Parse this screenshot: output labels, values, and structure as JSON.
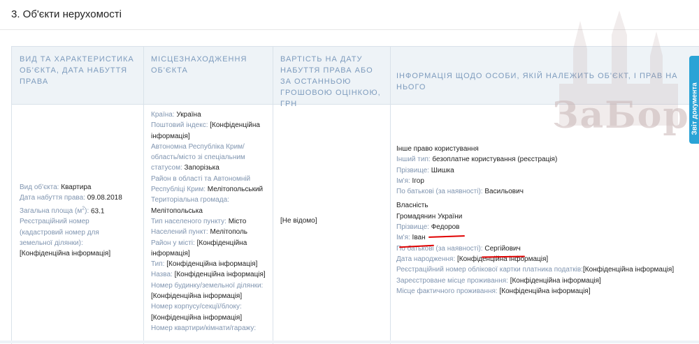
{
  "section": {
    "title": "3. Об'єкти нерухомості"
  },
  "headers": {
    "col1": "ВИД ТА ХАРАКТЕРИСТИКА ОБ'ЄКТА, ДАТА НАБУТТЯ ПРАВА",
    "col2": "МІСЦЕЗНАХОДЖЕННЯ ОБ'ЄКТА",
    "col3": "ВАРТІСТЬ НА ДАТУ НАБУТТЯ ПРАВА АБО ЗА ОСТАННЬОЮ ГРОШОВОЮ ОЦІНКОЮ, ГРН",
    "col4": "ІНФОРМАЦІЯ ЩОДО ОСОБИ, ЯКІЙ НАЛЕЖИТЬ ОБ'ЄКТ, І ПРАВ НА НЬОГО"
  },
  "object": {
    "type_label": "Вид об'єкта:",
    "type_value": "Квартира",
    "date_label": "Дата набуття права:",
    "date_value": "09.08.2018",
    "area_label": "Загальна площа (м",
    "area_sup": "2",
    "area_label_end": "):",
    "area_value": "63.1",
    "cadastral_line1": "Реєстраційний номер",
    "cadastral_line2": "(кадастровий номер для",
    "cadastral_line3": "земельної ділянки):",
    "cadastral_value": "[Конфіденційна інформація]"
  },
  "location": {
    "country_label": "Країна:",
    "country_value": "Україна",
    "postal_label": "Поштовий індекс:",
    "postal_value_1": "[Конфіденційна",
    "postal_value_2": "інформація]",
    "region_label_1": "Автономна Республіка Крим/",
    "region_label_2": "область/місто зі спеціальним",
    "region_label_3": "статусом:",
    "region_value": "Запорізька",
    "district_label_1": "Район в області та Автономній",
    "district_label_2": "Республіці Крим:",
    "district_value": "Мелітопольський",
    "community_label": "Територіальна громада:",
    "community_value": "Мелітопольська",
    "settlement_type_label": "Тип населеного пункту:",
    "settlement_type_value": "Місто",
    "settlement_label": "Населений пункт:",
    "settlement_value": "Мелітополь",
    "city_district_label": "Район у місті:",
    "city_district_value_1": "[Конфіденційна",
    "city_district_value_2": "інформація]",
    "type_label": "Тип:",
    "type_value": "[Конфіденційна інформація]",
    "name_label": "Назва:",
    "name_value": "[Конфіденційна інформація]",
    "house_label": "Номер будинку/земельної ділянки:",
    "house_value": "[Конфіденційна інформація]",
    "building_label": "Номер корпусу/секції/блоку:",
    "building_value": "[Конфіденційна інформація]",
    "apartment_label": "Номер квартири/кімнати/гаражу:"
  },
  "value": {
    "text": "[Не відомо]"
  },
  "owner": {
    "right_type": "Інше право користування",
    "other_type_label": "Інший тип:",
    "other_type_value": "безоплатне користування (реєстрація)",
    "surname1_label": "Прізвище:",
    "surname1_value": "Шишка",
    "name1_label": "Ім'я:",
    "name1_value": "Ігор",
    "patronymic1_label": "По батькові (за наявності):",
    "patronymic1_value": "Васильович",
    "ownership": "Власність",
    "citizen": "Громадянин України",
    "surname2_label": "Прізвище:",
    "surname2_value": "Федоров",
    "name2_label": "Ім'я:",
    "name2_value": "Іван",
    "patronymic2_label": "По батькові (за наявності):",
    "patronymic2_value": "Сергійович",
    "birth_label": "Дата народження:",
    "birth_value": "[Конфіденційна інформація]",
    "tax_label": "Реєстраційний номер облікової картки платника податків:",
    "tax_value": "[Конфіденційна інформація]",
    "reg_label": "Зареєстроване місце проживання:",
    "reg_value": "[Конфіденційна інформація]",
    "actual_label": "Місце фактичного проживання:",
    "actual_value": "[Конфіденційна інформація]"
  },
  "watermark": {
    "text": "ЗаБор",
    "color": "#c9b6b6"
  },
  "side_tab": {
    "label": "Звіт документа"
  },
  "colors": {
    "header_text": "#7d9bbd",
    "label_text": "#8095b0",
    "underline": "#e00000",
    "tab": "#2aa3d6"
  }
}
